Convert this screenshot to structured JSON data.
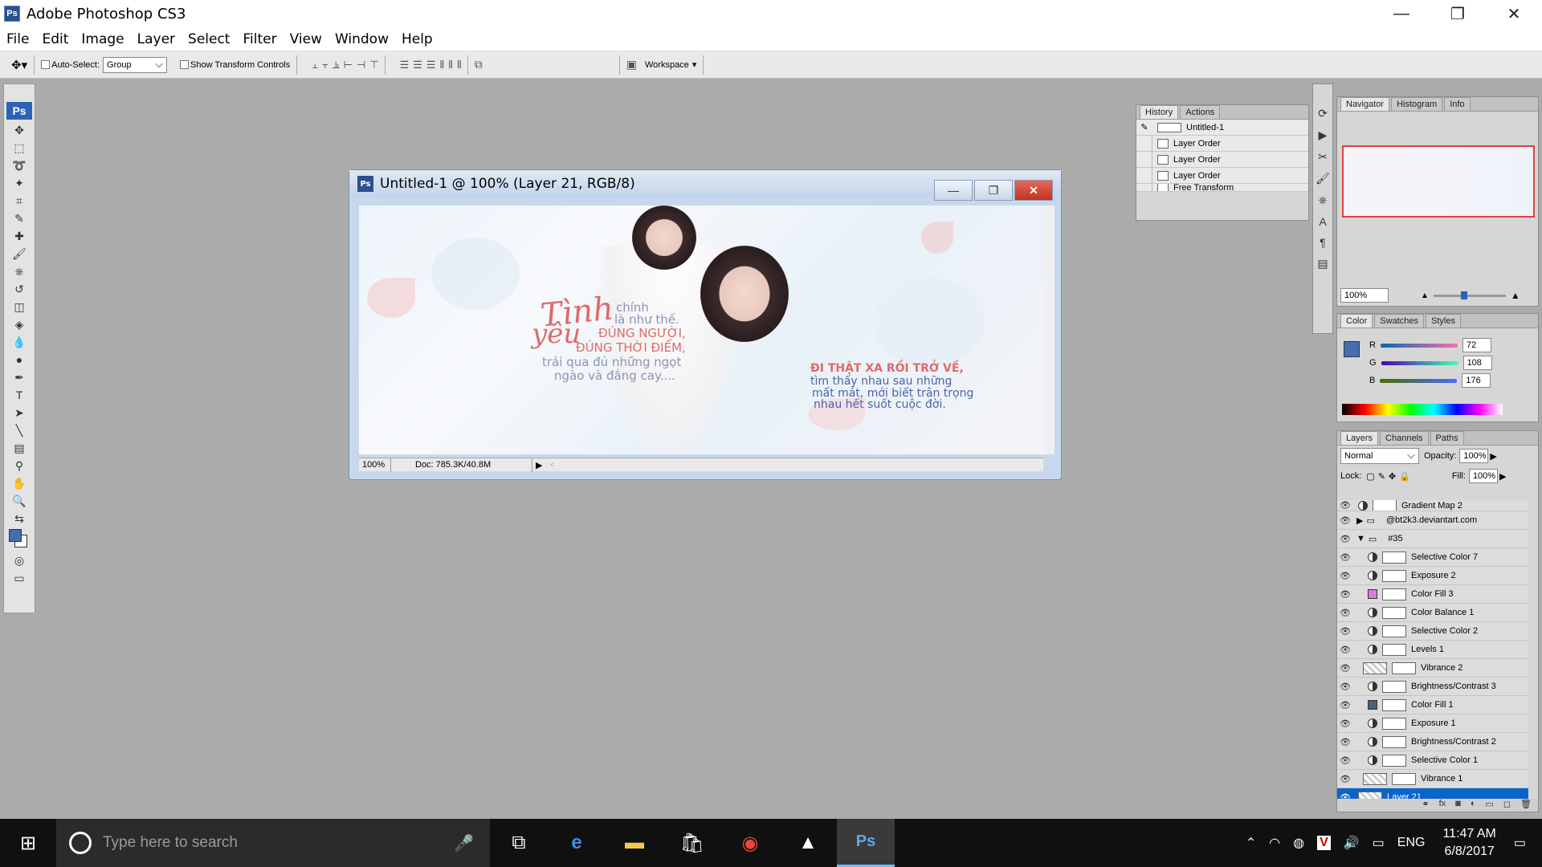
{
  "app": {
    "title": "Adobe Photoshop CS3",
    "logo": "Ps"
  },
  "window_controls": {
    "minimize": "—",
    "restore": "❐",
    "close": "✕"
  },
  "menu": [
    "File",
    "Edit",
    "Image",
    "Layer",
    "Select",
    "Filter",
    "View",
    "Window",
    "Help"
  ],
  "options": {
    "auto_select_label": "Auto-Select:",
    "auto_select_value": "Group",
    "show_transform_label": "Show Transform Controls",
    "workspace_label": "Workspace"
  },
  "toolbox": {
    "badge": "Ps",
    "foreground_color": "#486cb0",
    "background_color": "#ffffff"
  },
  "document": {
    "title": "Untitled-1 @ 100% (Layer 21, RGB/8)",
    "zoom": "100%",
    "doc_size": "Doc: 785.3K/40.8M",
    "artwork": {
      "word_tinh": "Tình",
      "word_yeu": "yêu",
      "line1": "chính",
      "line2": "là như thế.",
      "line3": "ĐÚNG NGƯỜI,",
      "line4": "ĐÚNG THỜI ĐIỂM,",
      "line5": "trải qua đủ những ngọt",
      "line6": "ngào và đắng cay....",
      "r_line1": "ĐI THẬT XA RỒI TRỞ VỀ,",
      "r_line2": "tìm thấy nhau sau những",
      "r_line3": "mất mát, mới biết trân trọng",
      "r_line4": "nhau hết suốt cuộc đời."
    }
  },
  "history_panel": {
    "tabs": [
      "History",
      "Actions"
    ],
    "snapshot": "Untitled-1",
    "items": [
      "Layer Order",
      "Layer Order",
      "Layer Order",
      "Free Transform"
    ]
  },
  "navigator_panel": {
    "tabs": [
      "Navigator",
      "Histogram",
      "Info"
    ],
    "zoom": "100%"
  },
  "color_panel": {
    "tabs": [
      "Color",
      "Swatches",
      "Styles"
    ],
    "swatch": "#486cb0",
    "r_label": "R",
    "r": "72",
    "g_label": "G",
    "g": "108",
    "b_label": "B",
    "b": "176"
  },
  "layers_panel": {
    "tabs": [
      "Layers",
      "Channels",
      "Paths"
    ],
    "blend_mode": "Normal",
    "opacity_label": "Opacity:",
    "opacity": "100%",
    "lock_label": "Lock:",
    "fill_label": "Fill:",
    "fill": "100%",
    "layers": [
      {
        "name": "Gradient Map 2"
      },
      {
        "name": "@bt2k3.deviantart.com"
      },
      {
        "name": "#35"
      },
      {
        "name": "Selective Color 7"
      },
      {
        "name": "Exposure 2"
      },
      {
        "name": "Color Fill 3"
      },
      {
        "name": "Color Balance 1"
      },
      {
        "name": "Selective Color 2"
      },
      {
        "name": "Levels 1"
      },
      {
        "name": "Vibrance 2"
      },
      {
        "name": "Brightness/Contrast 3"
      },
      {
        "name": "Color Fill 1"
      },
      {
        "name": "Exposure 1"
      },
      {
        "name": "Brightness/Contrast 2"
      },
      {
        "name": "Selective Color 1"
      },
      {
        "name": "Vibrance 1"
      },
      {
        "name": "Layer 21"
      }
    ]
  },
  "taskbar": {
    "search_placeholder": "Type here to search",
    "language": "ENG",
    "time": "11:47 AM",
    "date": "6/8/2017"
  }
}
